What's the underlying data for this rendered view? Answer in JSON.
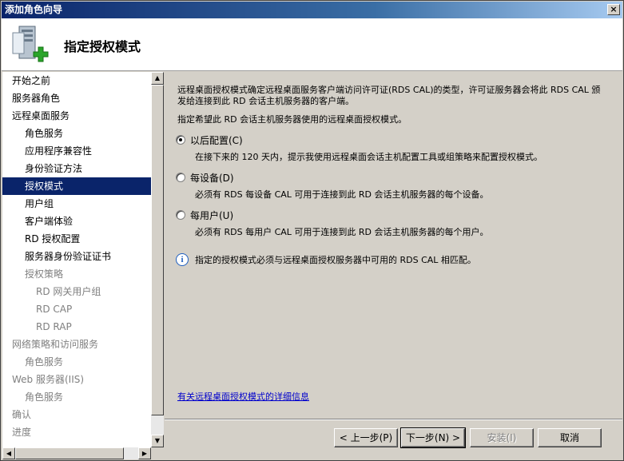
{
  "window": {
    "title": "添加角色向导"
  },
  "header": {
    "title": "指定授权模式",
    "icon": "server-add-icon"
  },
  "nav": {
    "items": [
      {
        "label": "开始之前",
        "level": 0,
        "state": "normal"
      },
      {
        "label": "服务器角色",
        "level": 0,
        "state": "normal"
      },
      {
        "label": "远程桌面服务",
        "level": 0,
        "state": "normal"
      },
      {
        "label": "角色服务",
        "level": 1,
        "state": "normal"
      },
      {
        "label": "应用程序兼容性",
        "level": 1,
        "state": "normal"
      },
      {
        "label": "身份验证方法",
        "level": 1,
        "state": "normal"
      },
      {
        "label": "授权模式",
        "level": 1,
        "state": "selected"
      },
      {
        "label": "用户组",
        "level": 1,
        "state": "normal"
      },
      {
        "label": "客户端体验",
        "level": 1,
        "state": "normal"
      },
      {
        "label": "RD 授权配置",
        "level": 1,
        "state": "normal"
      },
      {
        "label": "服务器身份验证证书",
        "level": 1,
        "state": "normal"
      },
      {
        "label": "授权策略",
        "level": 1,
        "state": "disabled"
      },
      {
        "label": "RD 网关用户组",
        "level": 2,
        "state": "disabled"
      },
      {
        "label": "RD CAP",
        "level": 2,
        "state": "disabled"
      },
      {
        "label": "RD RAP",
        "level": 2,
        "state": "disabled"
      },
      {
        "label": "网络策略和访问服务",
        "level": 0,
        "state": "disabled"
      },
      {
        "label": "角色服务",
        "level": 1,
        "state": "disabled"
      },
      {
        "label": "Web 服务器(IIS)",
        "level": 0,
        "state": "disabled"
      },
      {
        "label": "角色服务",
        "level": 1,
        "state": "disabled"
      },
      {
        "label": "确认",
        "level": 0,
        "state": "disabled"
      },
      {
        "label": "进度",
        "level": 0,
        "state": "disabled"
      }
    ]
  },
  "content": {
    "description": "远程桌面授权模式确定远程桌面服务客户端访问许可证(RDS CAL)的类型，许可证服务器会将此 RDS CAL 颁发给连接到此 RD 会话主机服务器的客户端。",
    "prompt": "指定希望此 RD 会话主机服务器使用的远程桌面授权模式。",
    "options": [
      {
        "label": "以后配置(C)",
        "selected": true,
        "desc": "在接下来的 120 天内，提示我使用远程桌面会话主机配置工具或组策略来配置授权模式。"
      },
      {
        "label": "每设备(D)",
        "selected": false,
        "desc": "必须有 RDS 每设备 CAL 可用于连接到此 RD 会话主机服务器的每个设备。"
      },
      {
        "label": "每用户(U)",
        "selected": false,
        "desc": "必须有 RDS 每用户 CAL 可用于连接到此 RD 会话主机服务器的每个用户。"
      }
    ],
    "info": "指定的授权模式必须与远程桌面授权服务器中可用的 RDS CAL 相匹配。",
    "link": "有关远程桌面授权模式的详细信息"
  },
  "buttons": {
    "prev": "< 上一步(P)",
    "next": "下一步(N) >",
    "install": "安装(I)",
    "cancel": "取消"
  }
}
